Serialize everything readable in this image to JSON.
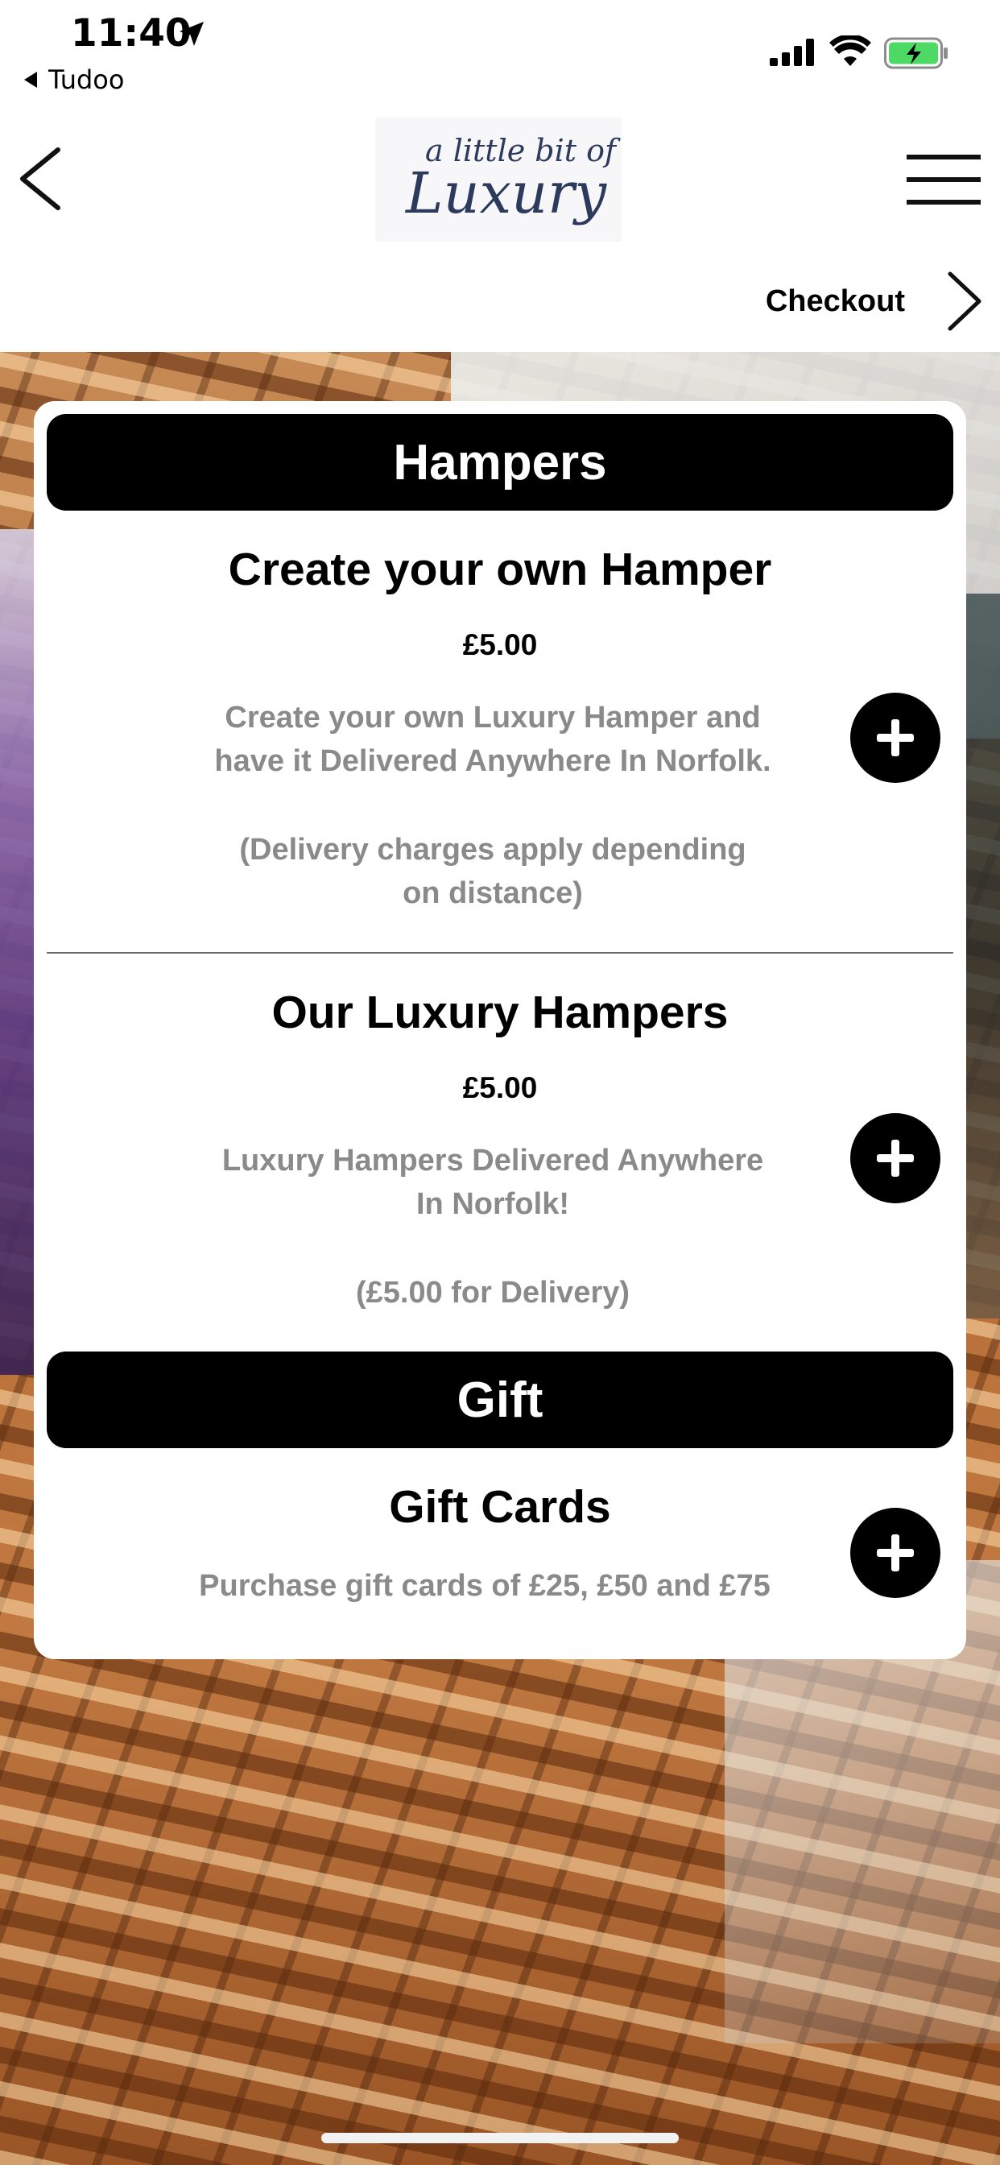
{
  "status_bar": {
    "time": "11:40",
    "back_app_label": "Tudoo"
  },
  "nav": {
    "logo_line1": "a little bit of",
    "logo_line2": "Luxury",
    "checkout_label": "Checkout"
  },
  "sections": [
    {
      "header": "Hampers",
      "items": [
        {
          "title": "Create your own Hamper",
          "price": "£5.00",
          "desc_line1": "Create your own Luxury Hamper and",
          "desc_line2": "have it Delivered Anywhere In Norfolk.",
          "note_line1": "(Delivery charges apply depending",
          "note_line2": "on distance)"
        },
        {
          "title": "Our Luxury Hampers",
          "price": "£5.00",
          "desc_line1": "Luxury Hampers Delivered Anywhere",
          "desc_line2": "In Norfolk!",
          "note_line1": "(£5.00 for Delivery)"
        }
      ]
    },
    {
      "header": "Gift",
      "items": [
        {
          "title": "Gift Cards",
          "desc_line1": "Purchase gift cards of £25, £50 and £75"
        }
      ]
    }
  ],
  "icons": {
    "location": "location-arrow-icon",
    "signal": "cellular-signal-icon",
    "wifi": "wifi-icon",
    "battery": "battery-charging-icon",
    "back": "chevron-left-icon",
    "menu": "hamburger-menu-icon",
    "checkout": "chevron-right-icon",
    "add": "plus-icon"
  },
  "colors": {
    "header_bg": "#000000",
    "desc_text": "#8a8a8a",
    "battery_fill": "#4cd964",
    "logo_ink": "#2c3a5c"
  }
}
